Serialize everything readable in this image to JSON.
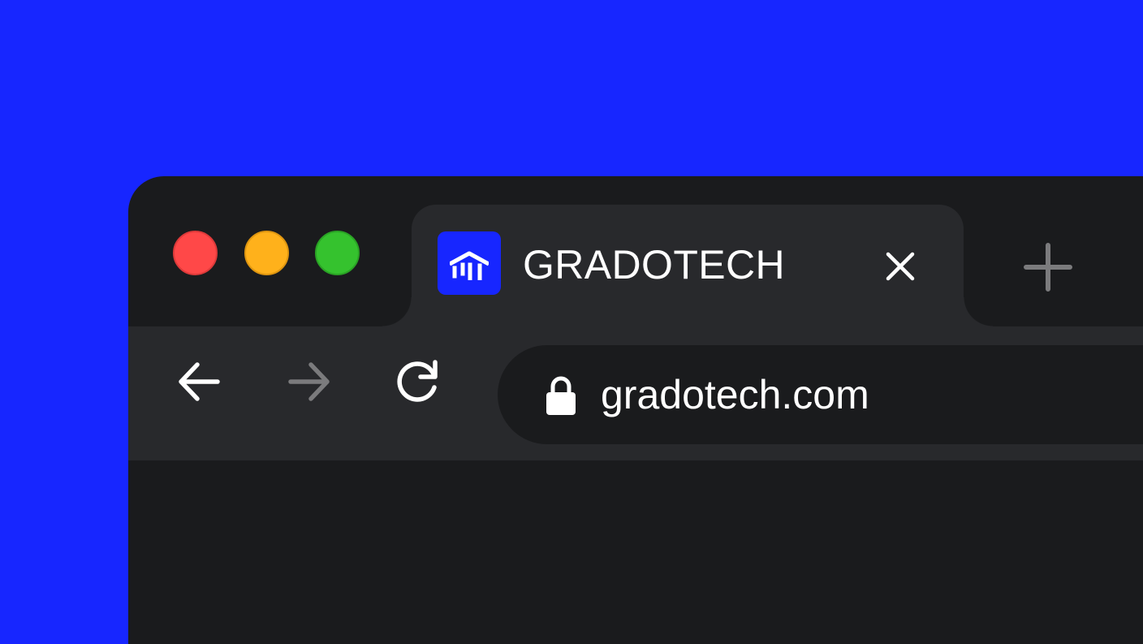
{
  "colors": {
    "background": "#1726ff",
    "window": "#1a1b1d",
    "tab_and_toolbar": "#28292c",
    "traffic_red": "#ff4848",
    "traffic_yellow": "#ffb11b",
    "traffic_green": "#35c22e",
    "favicon_background": "#1726ff",
    "foreground": "#ffffff",
    "muted_icon": "#7b7b7d"
  },
  "window_controls": [
    {
      "name": "close",
      "color": "#ff4848"
    },
    {
      "name": "minimize",
      "color": "#ffb11b"
    },
    {
      "name": "maximize",
      "color": "#35c22e"
    }
  ],
  "tab": {
    "title": "GRADOTECH",
    "favicon_icon": "gradotech-logo-icon",
    "close_icon": "close-icon"
  },
  "new_tab": {
    "icon": "plus-icon"
  },
  "toolbar": {
    "back_icon": "arrow-left-icon",
    "forward_icon": "arrow-right-icon",
    "forward_disabled": true,
    "reload_icon": "reload-icon"
  },
  "address_bar": {
    "lock_icon": "lock-icon",
    "url": "gradotech.com"
  }
}
